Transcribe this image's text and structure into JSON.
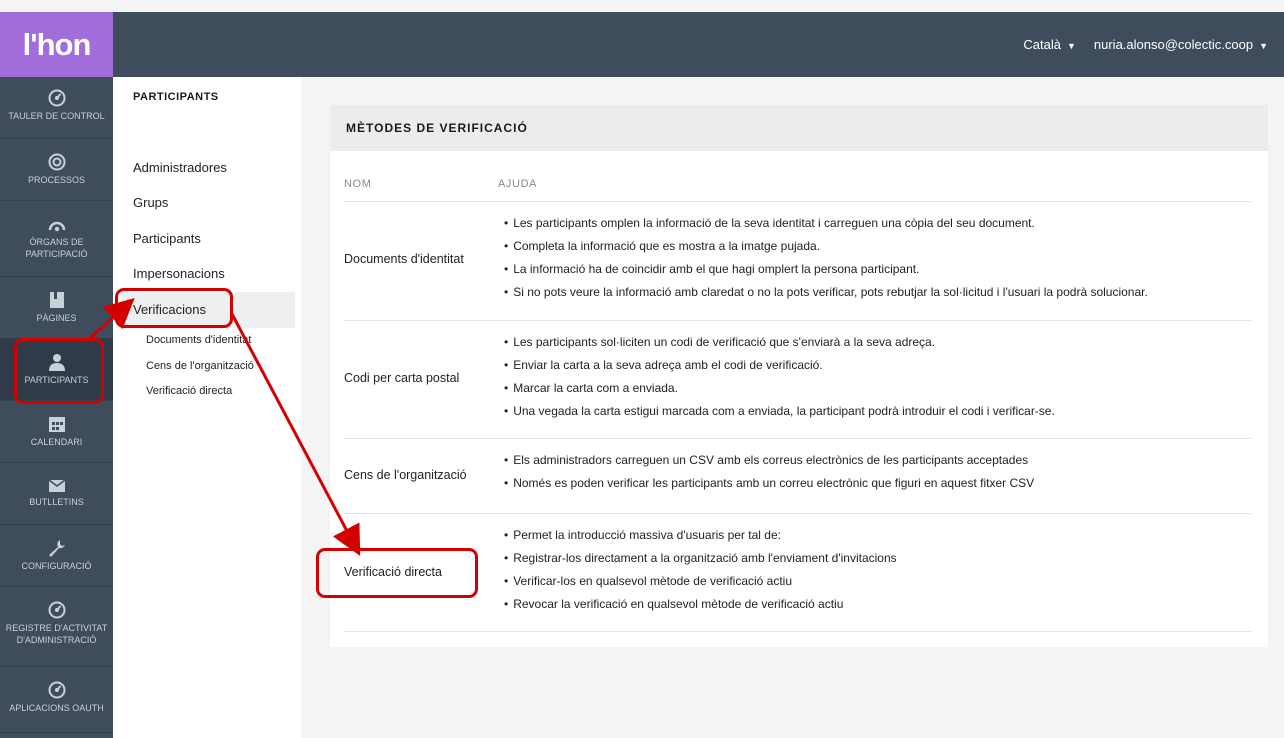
{
  "header": {
    "logo": "l'hon",
    "language": "Català",
    "user": "nuria.alonso@colectic.coop"
  },
  "iconbar": {
    "items": [
      {
        "label": "TAULER DE CONTROL",
        "icon": "dashboard-icon"
      },
      {
        "label": "PROCESSOS",
        "icon": "target-icon"
      },
      {
        "label": "ÒRGANS DE PARTICIPACIÓ",
        "icon": "assembly-icon"
      },
      {
        "label": "PÀGINES",
        "icon": "book-icon"
      },
      {
        "label": "PARTICIPANTS",
        "icon": "user-icon"
      },
      {
        "label": "CALENDARI",
        "icon": "calendar-icon"
      },
      {
        "label": "BUTLLETINS",
        "icon": "envelope-icon"
      },
      {
        "label": "CONFIGURACIÓ",
        "icon": "wrench-icon"
      },
      {
        "label": "REGISTRE D'ACTIVITAT D'ADMINISTRACIÓ",
        "icon": "dashboard-icon"
      },
      {
        "label": "APLICACIONS OAUTH",
        "icon": "dashboard-icon"
      }
    ]
  },
  "submenu": {
    "title": "PARTICIPANTS",
    "items": [
      "Administradores",
      "Grups",
      "Participants",
      "Impersonacions",
      "Verificacions"
    ],
    "children": [
      "Documents d'identitat",
      "Cens de l'organització",
      "Verificació directa"
    ]
  },
  "card": {
    "title": "MÈTODES DE VERIFICACIÓ",
    "columns": [
      "NOM",
      "AJUDA"
    ],
    "rows": [
      {
        "name": "Documents d'identitat",
        "help": [
          "Les participants omplen la informació de la seva identitat i carreguen una còpia del seu document.",
          "Completa la informació que es mostra a la imatge pujada.",
          "La informació ha de coincidir amb el que hagi omplert la persona participant.",
          "Si no pots veure la informació amb claredat o no la pots verificar, pots rebutjar la sol·licitud i l'usuari la podrà solucionar."
        ]
      },
      {
        "name": "Codi per carta postal",
        "help": [
          "Les participants sol·liciten un codi de verificació que s'enviarà a la seva adreça.",
          "Enviar la carta a la seva adreça amb el codi de verificació.",
          "Marcar la carta com a enviada.",
          "Una vegada la carta estigui marcada com a enviada, la participant podrà introduir el codi i verificar-se."
        ]
      },
      {
        "name": "Cens de l'organització",
        "help": [
          "Els administradors carreguen un CSV amb els correus electrònics de les participants acceptades",
          "Només es poden verificar les participants amb un correu electrònic que figuri en aquest fitxer CSV"
        ]
      },
      {
        "name": "Verificació directa",
        "help": [
          "Permet la introducció massiva d'usuaris per tal de:",
          "Registrar-los directament a la organització amb l'enviament d'invitacions",
          "Verificar-los en qualsevol mètode de verificació actiu",
          "Revocar la verificació en qualsevol mètode de verificació actiu"
        ]
      }
    ]
  },
  "colors": {
    "sidebar": "#3e4c5c",
    "logo_bg": "#a06ddb",
    "annotation": "#d40000"
  }
}
